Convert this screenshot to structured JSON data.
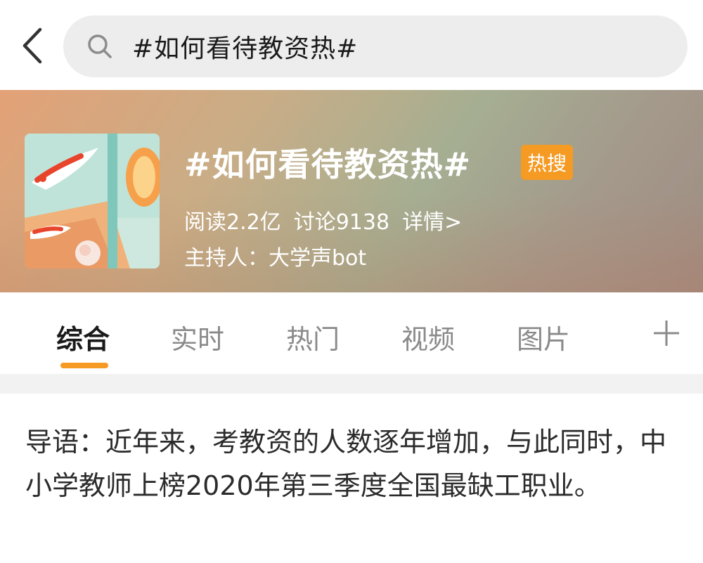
{
  "search": {
    "query": "#如何看待教资热#"
  },
  "topic": {
    "title": "#如何看待教资热#",
    "badge": "热搜",
    "reads": "阅读2.2亿",
    "discussions": "讨论9138",
    "details_link": "详情>",
    "host": "主持人：大学声bot"
  },
  "tabs": [
    {
      "label": "综合"
    },
    {
      "label": "实时"
    },
    {
      "label": "热门"
    },
    {
      "label": "视频"
    },
    {
      "label": "图片"
    }
  ],
  "intro": {
    "text": "导语：近年来，考教资的人数逐年增加，与此同时，中小学教师上榜2020年第三季度全国最缺工职业。"
  },
  "icons": {
    "back": "chevron-left-icon",
    "search": "search-icon",
    "add_tab": "plus-icon"
  },
  "colors": {
    "accent": "#f59a23",
    "badge_bg": "#f59a23",
    "search_bg": "#ededed"
  }
}
